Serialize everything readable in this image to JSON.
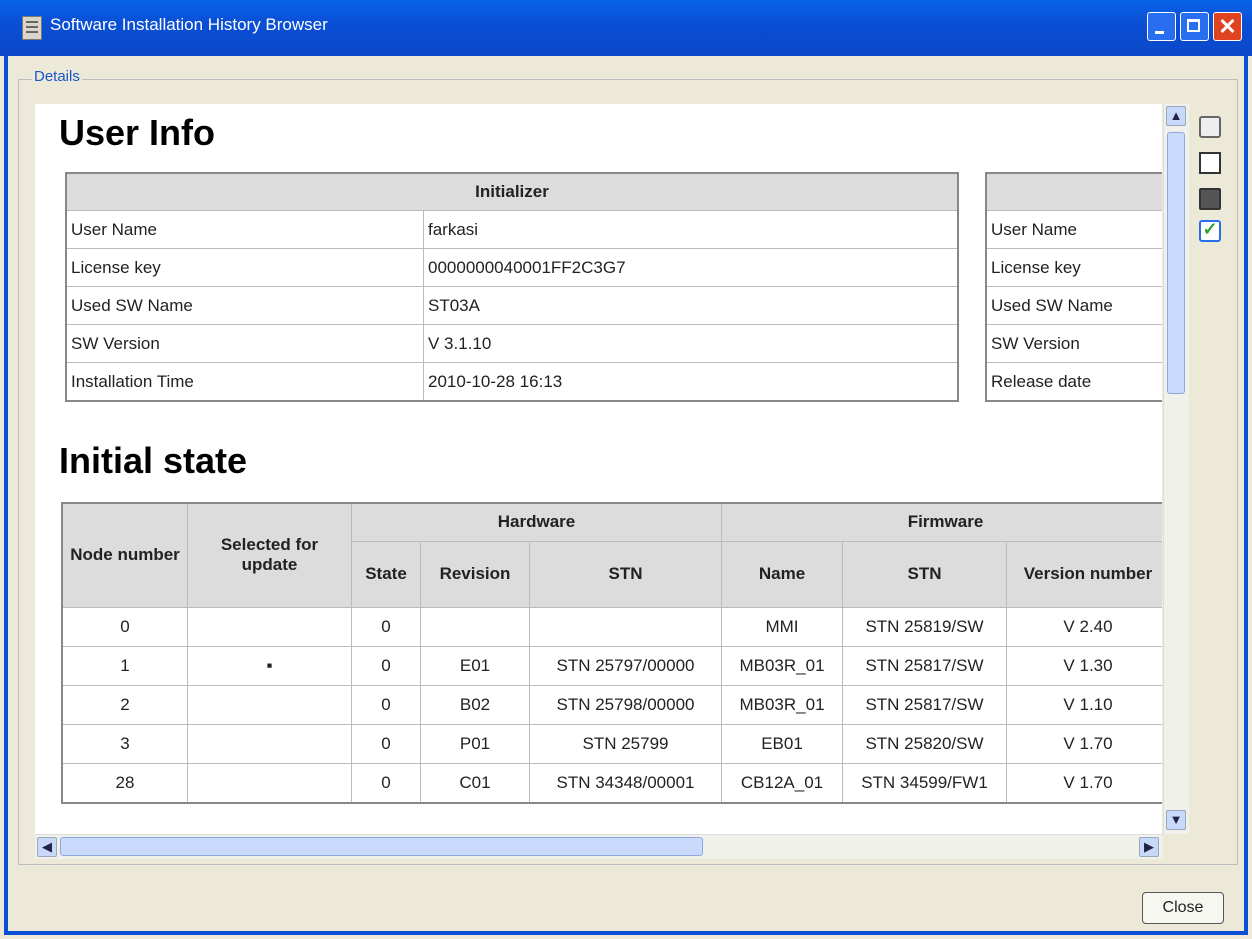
{
  "window": {
    "title": "Software Installation History Browser"
  },
  "groupbox": {
    "label": "Details"
  },
  "user_info": {
    "heading": "User Info",
    "initializer": {
      "header": "Initializer",
      "rows": [
        {
          "label": "User Name",
          "value": "farkasi"
        },
        {
          "label": "License key",
          "value": "0000000040001FF2C3G7"
        },
        {
          "label": "Used SW Name",
          "value": "ST03A"
        },
        {
          "label": "SW Version",
          "value": "V 3.1.10"
        },
        {
          "label": "Installation Time",
          "value": "2010-10-28 16:13"
        }
      ]
    },
    "second": {
      "header": "",
      "rows": [
        "User Name",
        "License key",
        "Used SW Name",
        "SW Version",
        "Release date"
      ]
    }
  },
  "initial_state": {
    "heading": "Initial state",
    "headers": {
      "node_number": "Node number",
      "selected": "Selected for update",
      "hardware": "Hardware",
      "firmware": "Firmware",
      "state": "State",
      "revision": "Revision",
      "hw_stn": "STN",
      "name": "Name",
      "fw_stn": "STN",
      "version": "Version number"
    },
    "rows": [
      {
        "node": "0",
        "sel": "",
        "state": "0",
        "rev": "",
        "hwstn": "",
        "name": "MMI",
        "fwstn": "STN 25819/SW",
        "ver": "V 2.40"
      },
      {
        "node": "1",
        "sel": "▪",
        "state": "0",
        "rev": "E01",
        "hwstn": "STN 25797/00000",
        "name": "MB03R_01",
        "fwstn": "STN 25817/SW",
        "ver": "V 1.30"
      },
      {
        "node": "2",
        "sel": "",
        "state": "0",
        "rev": "B02",
        "hwstn": "STN 25798/00000",
        "name": "MB03R_01",
        "fwstn": "STN 25817/SW",
        "ver": "V 1.10"
      },
      {
        "node": "3",
        "sel": "",
        "state": "0",
        "rev": "P01",
        "hwstn": "STN 25799",
        "name": "EB01",
        "fwstn": "STN 25820/SW",
        "ver": "V 1.70"
      },
      {
        "node": "28",
        "sel": "",
        "state": "0",
        "rev": "C01",
        "hwstn": "STN 34348/00001",
        "name": "CB12A_01",
        "fwstn": "STN 34599/FW1",
        "ver": "V 1.70"
      }
    ]
  },
  "toolbar": {
    "icons": [
      "print-icon",
      "print-preview-icon",
      "save-icon",
      "check-icon"
    ]
  },
  "buttons": {
    "close": "Close"
  }
}
